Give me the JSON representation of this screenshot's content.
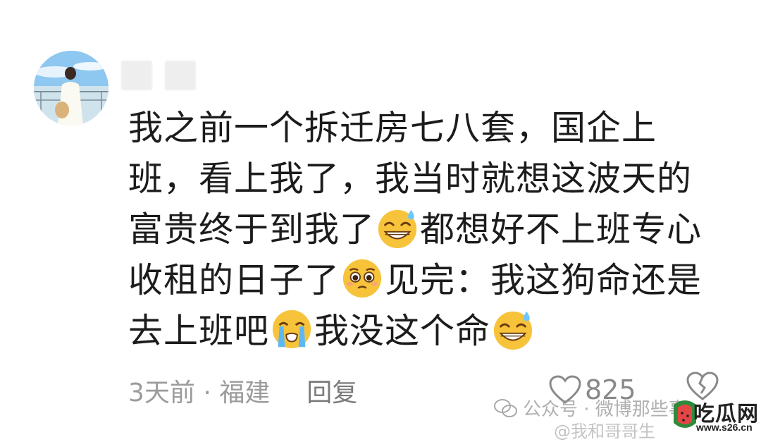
{
  "comment": {
    "username": "",
    "text_lines": [
      [
        "我之前一个拆迁房七八套，国企上"
      ],
      [
        "班，看上我了，我当时就想这波天的"
      ],
      [
        "富贵终于到我了",
        "{emoji:grin-sweat}",
        "都想好不上班专心"
      ],
      [
        "收租的日子了",
        "{emoji:pleading}",
        "见完：我这狗命还是"
      ],
      [
        "去上班吧",
        "{emoji:crying}",
        "我没这个命",
        "{emoji:grin-sweat}"
      ]
    ],
    "parts": {
      "l1": "我之前一个拆迁房七八套，国企上",
      "l2": "班，看上我了，我当时就想这波天的",
      "l3a": "富贵终于到我了",
      "l3b": "都想好不上班专心",
      "l4a": "收租的日子了",
      "l4b": "见完：我这狗命还是",
      "l5a": "去上班吧",
      "l5b": "我没这个命"
    },
    "emojis": [
      "grin-sweat-icon",
      "pleading-icon",
      "crying-icon",
      "grin-sweat-icon"
    ],
    "time_location": "3天前 · 福建",
    "reply_label": "回复",
    "like_count": "825"
  },
  "watermark": {
    "line1": "公众号 · 微博那些事",
    "line2": "@我和哥哥生",
    "brand": "吃瓜网",
    "site": "www.s26.cn"
  },
  "colors": {
    "text": "#1c1c1c",
    "meta": "#9b9b9b",
    "emoji_yellow": "#f7c33a"
  }
}
